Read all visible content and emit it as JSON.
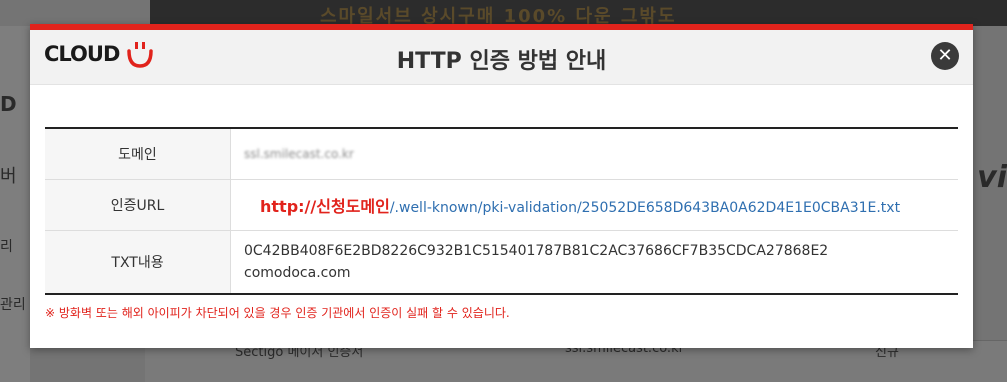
{
  "background": {
    "banner_text": "스마일서브 상시구매 100% 다운 그밖도",
    "left_labels": [
      "D",
      "버",
      "리",
      "관리"
    ],
    "right_text": "vi",
    "bottom_row": {
      "col1": "Sectigo 메이저 인증서",
      "col2": "ssl.smilecast.co.kr",
      "col3": "신규"
    }
  },
  "modal": {
    "logo_text": "CLOUD",
    "title": "HTTP 인증 방법 안내",
    "close_icon": "close-icon",
    "rows": {
      "domain": {
        "label": "도메인",
        "value": "ssl.smilecast.co.kr"
      },
      "url": {
        "label": "인증URL",
        "prefix": "http://신청도메인",
        "path": "/.well-known/pki-validation/25052DE658D643BA0A62D4E1E0CBA31E.txt"
      },
      "txt": {
        "label": "TXT내용",
        "line1": "0C42BB408F6E2BD8226C932B1C515401787B81C2AC37686CF7B35CDCA27868E2",
        "line2": "comodoca.com"
      }
    },
    "note": "※ 방화벽 또는 해외 아이피가 차단되어 있을 경우 인증 기관에서 인증이 실패 할 수 있습니다."
  },
  "colors": {
    "accent": "#e1231c",
    "link": "#2f6fb0",
    "header_bg": "#f2f2f2"
  }
}
